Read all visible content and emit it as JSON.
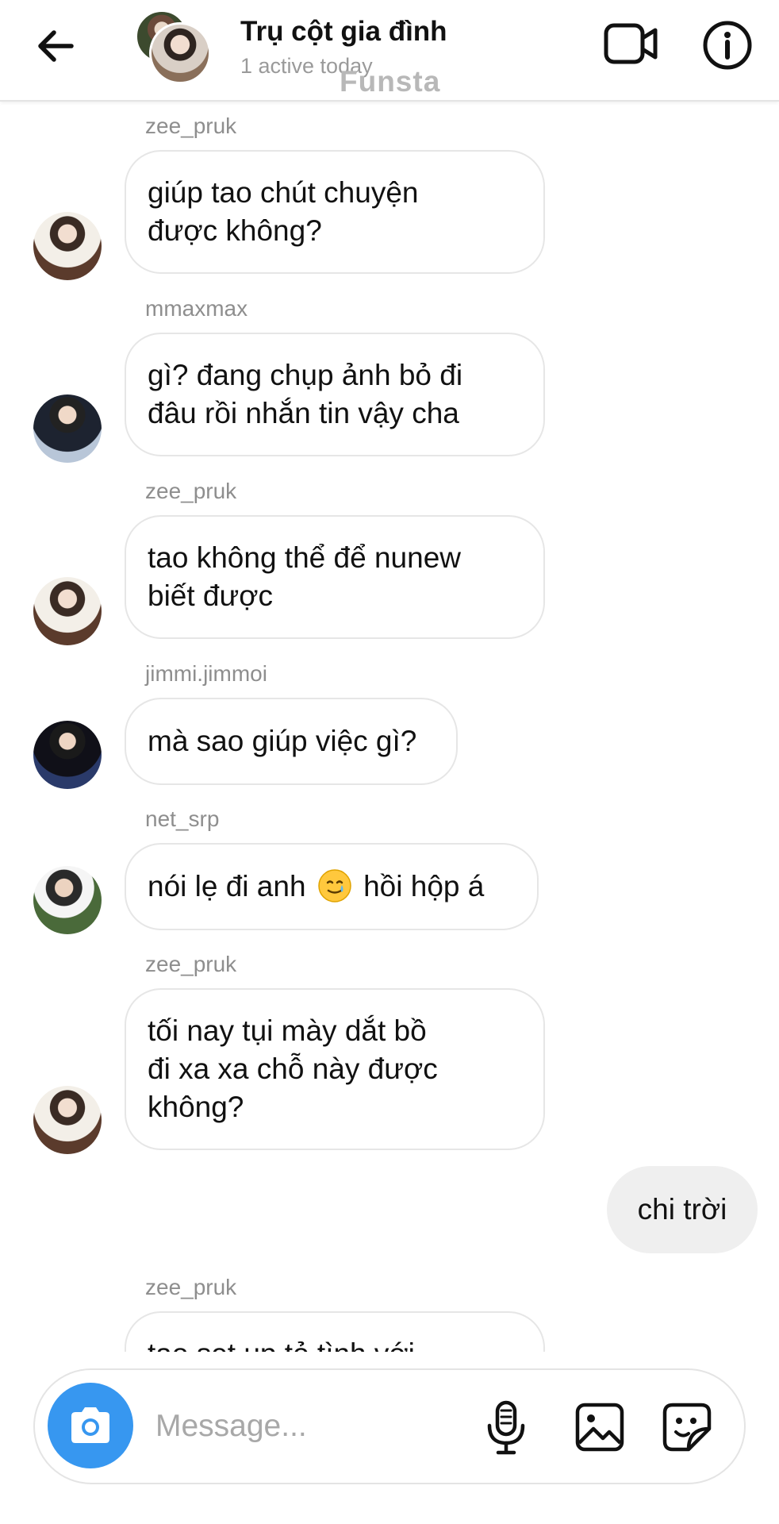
{
  "header": {
    "title": "Trụ cột gia đình",
    "status": "1 active today",
    "watermark": "Funsta",
    "back_icon": "arrow-left-icon",
    "video_icon": "video-call-icon",
    "info_icon": "info-icon"
  },
  "messages": [
    {
      "sender": "zee_pruk",
      "lines": [
        "giúp tao chút chuyện",
        "được không?"
      ]
    },
    {
      "sender": "mmaxmax",
      "lines": [
        "gì? đang chụp ảnh bỏ đi",
        "đâu rồi nhắn tin vậy cha"
      ]
    },
    {
      "sender": "zee_pruk",
      "lines": [
        "tao không thể để nunew",
        "biết được"
      ]
    },
    {
      "sender": "jimmi.jimmoi",
      "lines": [
        "mà sao giúp việc gì?"
      ]
    },
    {
      "sender": "net_srp",
      "before_emoji": "nói lẹ đi anh",
      "emoji": "🥲",
      "after_emoji": "hồi hộp á"
    },
    {
      "sender": "zee_pruk",
      "lines": [
        "tối nay tụi mày dắt bồ",
        "đi xa xa chỗ này được",
        "không?"
      ]
    },
    {
      "sender": "zee_pruk",
      "lines": [
        "tao set up tỏ tình với"
      ]
    }
  ],
  "my_message": "chi trời",
  "composer": {
    "placeholder": "Message...",
    "camera_icon": "camera-icon",
    "mic_icon": "microphone-icon",
    "gallery_icon": "gallery-icon",
    "sticker_icon": "sticker-icon"
  },
  "colors": {
    "accent": "#3797f0",
    "bubble_border": "#e6e6e6",
    "my_bubble": "#efefef",
    "muted_text": "#8e8e8e"
  }
}
